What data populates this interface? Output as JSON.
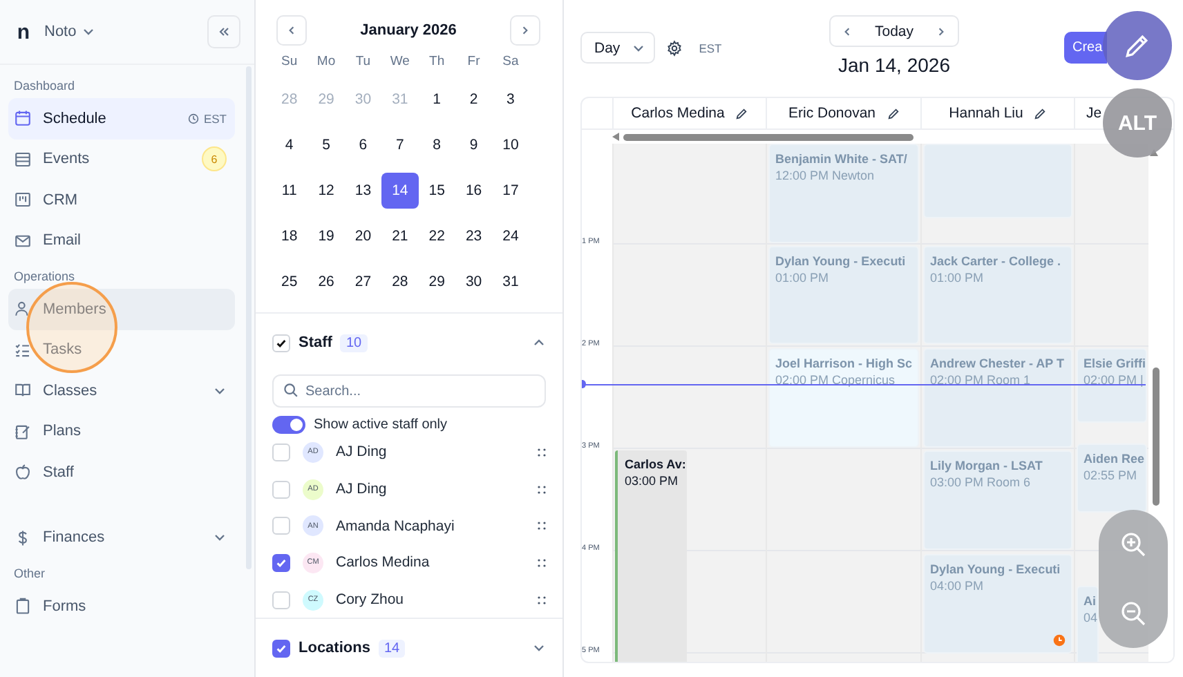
{
  "sidebar": {
    "logo": "n",
    "workspace": "Noto",
    "sections": [
      {
        "label": "Dashboard",
        "items": [
          {
            "label": "Schedule",
            "selected": true,
            "hovered": false,
            "submenu": false,
            "tag": "EST"
          },
          {
            "label": "Events",
            "selected": false,
            "hovered": false,
            "submenu": false,
            "badge": "6"
          },
          {
            "label": "CRM",
            "selected": false,
            "hovered": false,
            "submenu": false
          },
          {
            "label": "Email",
            "selected": false,
            "hovered": false,
            "submenu": false
          }
        ]
      },
      {
        "label": "Operations",
        "items": [
          {
            "label": "Members",
            "selected": false,
            "hovered": true,
            "submenu": false
          },
          {
            "label": "Tasks",
            "selected": false,
            "hovered": false,
            "submenu": false
          },
          {
            "label": "Classes",
            "selected": false,
            "hovered": false,
            "submenu": true
          },
          {
            "label": "Plans",
            "selected": false,
            "hovered": false,
            "submenu": false
          },
          {
            "label": "Staff",
            "selected": false,
            "hovered": false,
            "submenu": false
          }
        ]
      },
      {
        "items": [
          {
            "label": "Finances",
            "selected": false,
            "hovered": false,
            "submenu": true
          }
        ]
      },
      {
        "label": "Other",
        "items": [
          {
            "label": "Forms",
            "selected": false,
            "hovered": false,
            "submenu": false
          }
        ]
      }
    ]
  },
  "mini_calendar": {
    "month": "January 2026",
    "weekdays": [
      "Su",
      "Mo",
      "Tu",
      "We",
      "Th",
      "Fr",
      "Sa"
    ],
    "weeks": [
      [
        {
          "day": "28",
          "muted": true,
          "selected": false
        },
        {
          "day": "29",
          "muted": true,
          "selected": false
        },
        {
          "day": "30",
          "muted": true,
          "selected": false
        },
        {
          "day": "31",
          "muted": true,
          "selected": false
        },
        {
          "day": "1",
          "muted": false,
          "selected": false
        },
        {
          "day": "2",
          "muted": false,
          "selected": false
        },
        {
          "day": "3",
          "muted": false,
          "selected": false
        }
      ],
      [
        {
          "day": "4",
          "muted": false,
          "selected": false
        },
        {
          "day": "5",
          "muted": false,
          "selected": false
        },
        {
          "day": "6",
          "muted": false,
          "selected": false
        },
        {
          "day": "7",
          "muted": false,
          "selected": false
        },
        {
          "day": "8",
          "muted": false,
          "selected": false
        },
        {
          "day": "9",
          "muted": false,
          "selected": false
        },
        {
          "day": "10",
          "muted": false,
          "selected": false
        }
      ],
      [
        {
          "day": "11",
          "muted": false,
          "selected": false
        },
        {
          "day": "12",
          "muted": false,
          "selected": false
        },
        {
          "day": "13",
          "muted": false,
          "selected": false
        },
        {
          "day": "14",
          "muted": false,
          "selected": true
        },
        {
          "day": "15",
          "muted": false,
          "selected": false
        },
        {
          "day": "16",
          "muted": false,
          "selected": false
        },
        {
          "day": "17",
          "muted": false,
          "selected": false
        }
      ],
      [
        {
          "day": "18",
          "muted": false,
          "selected": false
        },
        {
          "day": "19",
          "muted": false,
          "selected": false
        },
        {
          "day": "20",
          "muted": false,
          "selected": false
        },
        {
          "day": "21",
          "muted": false,
          "selected": false
        },
        {
          "day": "22",
          "muted": false,
          "selected": false
        },
        {
          "day": "23",
          "muted": false,
          "selected": false
        },
        {
          "day": "24",
          "muted": false,
          "selected": false
        }
      ],
      [
        {
          "day": "25",
          "muted": false,
          "selected": false
        },
        {
          "day": "26",
          "muted": false,
          "selected": false
        },
        {
          "day": "27",
          "muted": false,
          "selected": false
        },
        {
          "day": "28",
          "muted": false,
          "selected": false
        },
        {
          "day": "29",
          "muted": false,
          "selected": false
        },
        {
          "day": "30",
          "muted": false,
          "selected": false
        },
        {
          "day": "31",
          "muted": false,
          "selected": false
        }
      ]
    ]
  },
  "staff": {
    "title": "Staff",
    "checked": true,
    "count": "10",
    "expanded": true,
    "search": {
      "placeholder": "Search..."
    },
    "toggle": {
      "label": "Show active staff only",
      "on": true
    },
    "members": [
      {
        "initials": "AD",
        "name": "AJ Ding",
        "color": "#e0e7ff",
        "checked": false
      },
      {
        "initials": "AD",
        "name": "AJ Ding",
        "color": "#ecfccb",
        "checked": false
      },
      {
        "initials": "AN",
        "name": "Amanda Ncaphayi",
        "color": "#e0e7ff",
        "checked": false
      },
      {
        "initials": "CM",
        "name": "Carlos Medina",
        "color": "#fce7f3",
        "checked": true
      },
      {
        "initials": "CZ",
        "name": "Cory Zhou",
        "color": "#cffafe",
        "checked": false
      }
    ]
  },
  "locations": {
    "title": "Locations",
    "checked": true,
    "count": "14",
    "expanded": false
  },
  "toolbar": {
    "view": "Day",
    "timezone": "EST",
    "today": "Today",
    "date": "Jan 14, 2026",
    "create": "Crea"
  },
  "schedule": {
    "hours": [
      "1 PM",
      "2 PM",
      "3 PM",
      "4 PM",
      "5 PM"
    ],
    "columns": [
      {
        "name": "Carlos Medina",
        "editable": true,
        "events": [
          {
            "kind": "block",
            "title": "Carlos Av:",
            "detail": "03:00 PM"
          }
        ]
      },
      {
        "name": "Eric Donovan",
        "editable": true,
        "events": [
          {
            "kind": "lesson",
            "title": "Benjamin White - SAT/",
            "detail": "12:00 PM Newton",
            "alert": false
          },
          {
            "kind": "lesson",
            "title": "Dylan Young - Executi",
            "detail": "01:00 PM",
            "alert": false
          },
          {
            "kind": "highlight",
            "title": "Joel Harrison - High Sc",
            "detail": "02:00 PM Copernicus",
            "alert": false
          }
        ]
      },
      {
        "name": "Hannah Liu",
        "editable": true,
        "events": [
          {
            "kind": "lesson",
            "alert": false
          },
          {
            "kind": "lesson",
            "title": "Jack Carter - College .",
            "detail": "01:00 PM",
            "alert": false
          },
          {
            "kind": "lesson",
            "title": "Andrew Chester - AP T",
            "detail": "02:00 PM Room 1",
            "alert": false
          },
          {
            "kind": "lesson",
            "title": "Lily Morgan - LSAT",
            "detail": "03:00 PM Room 6",
            "alert": false
          },
          {
            "kind": "lesson",
            "title": "Dylan Young - Executi",
            "detail": "04:00 PM",
            "alert": true
          }
        ]
      },
      {
        "name": "Je",
        "editable": false,
        "events": [
          {
            "kind": "lesson",
            "title": "Elsie Griffi",
            "detail": "02:00 PM |",
            "alert": false
          },
          {
            "kind": "lesson",
            "title": "Aiden Ree",
            "detail": "02:55 PM",
            "alert": false
          },
          {
            "kind": "lesson",
            "title": "Ai",
            "detail": "04"
          }
        ]
      }
    ]
  },
  "overlay": {
    "alt": "ALT"
  }
}
